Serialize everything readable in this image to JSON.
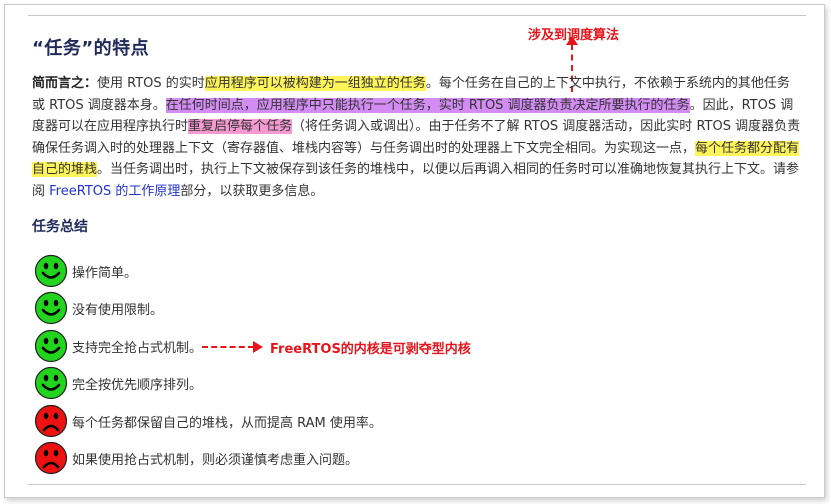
{
  "title": "“任务”的特点",
  "annotation_top": "涉及到调度算法",
  "annotation_row": "FreeRTOS的内核是可剥夺型内核",
  "paragraph": {
    "lead": "简而言之：",
    "t1": "使用 RTOS 的实时",
    "h1": "应用程序可以被构建为一组独立的任务",
    "t2": "。每个任务在自己的上下文中执行，不依赖于系统内的其他任务或 RTOS 调度器本身。",
    "h2": "在任何时间点，应用程序中只能执行一个任务，实时 RTOS 调度器负责决定所要执行的任务",
    "t3": "。因此，RTOS 调度器可以在应用程序执行时",
    "h3": "重复启停每个任务",
    "t4": "（将任务调入或调出）。由于任务不了解 RTOS 调度器活动，因此实时 RTOS 调度器负责确保任务调入时的处理器上下文（寄存器值、堆栈内容等）与任务调出时的处理器上下文完全相同。为实现这一点，",
    "h4": "每个任务都分配有自己的堆栈",
    "t5": "。当任务调出时，执行上下文被保存到该任务的堆栈中，以便以后再调入相同的任务时可以准确地恢复其执行上下文。请参阅 ",
    "link": "FreeRTOS 的工作原理",
    "t6": "部分，以获取更多信息。"
  },
  "summary_heading": "任务总结",
  "colors": {
    "good": "#22d41e",
    "bad": "#ee1111",
    "accent": "#e8141c"
  },
  "summary_items": [
    {
      "text": "操作简单。",
      "sentiment": "smile-icon"
    },
    {
      "text": "没有使用限制。",
      "sentiment": "smile-icon"
    },
    {
      "text": "支持完全抢占式机制。",
      "sentiment": "smile-icon"
    },
    {
      "text": "完全按优先顺序排列。",
      "sentiment": "smile-icon"
    },
    {
      "text": "每个任务都保留自己的堆栈，从而提高 RAM 使用率。",
      "sentiment": "frown-icon"
    },
    {
      "text": "如果使用抢占式机制，则必须谨慎考虑重入问题。",
      "sentiment": "frown-icon"
    }
  ]
}
